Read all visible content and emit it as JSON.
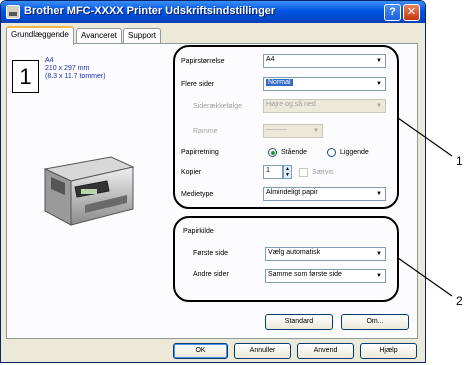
{
  "window": {
    "title": "Brother MFC-XXXX Printer Udskriftsindstillinger"
  },
  "tabs": [
    "Grundlæggende",
    "Avanceret",
    "Support"
  ],
  "preview": {
    "page_number": "1",
    "paper_name": "A4",
    "size_mm": "210 x 297 mm",
    "size_in": "(8.3 x 11.7 tommer)"
  },
  "settings": {
    "paper_size": {
      "label": "Papirstørrelse",
      "value": "A4"
    },
    "multiple_pages": {
      "label": "Flere sider",
      "value": "Normal"
    },
    "page_order": {
      "label": "Siderækkefølge",
      "value": "Højre og så ned"
    },
    "border": {
      "label": "Ramme",
      "value": "———"
    },
    "orientation": {
      "label": "Papirretning",
      "portrait": "Stående",
      "landscape": "Liggende",
      "selected": "portrait"
    },
    "copies": {
      "label": "Kopier",
      "value": "1",
      "collate_label": "Sætvis",
      "collate_checked": false
    },
    "media_type": {
      "label": "Medietype",
      "value": "Almindeligt papir"
    }
  },
  "paper_source": {
    "group_label": "Papirkilde",
    "first_page": {
      "label": "Første side",
      "value": "Vælg automatisk"
    },
    "other_pages": {
      "label": "Andre sider",
      "value": "Samme som første side"
    }
  },
  "buttons": {
    "default": "Standard",
    "about": "Om...",
    "ok": "OK",
    "cancel": "Annuller",
    "apply": "Anvend",
    "help": "Hjælp"
  },
  "callouts": [
    "1",
    "2"
  ],
  "colors": {
    "titlebar": "#0054e3",
    "selection": "#316ac5",
    "dialog_bg": "#ece9d8"
  }
}
